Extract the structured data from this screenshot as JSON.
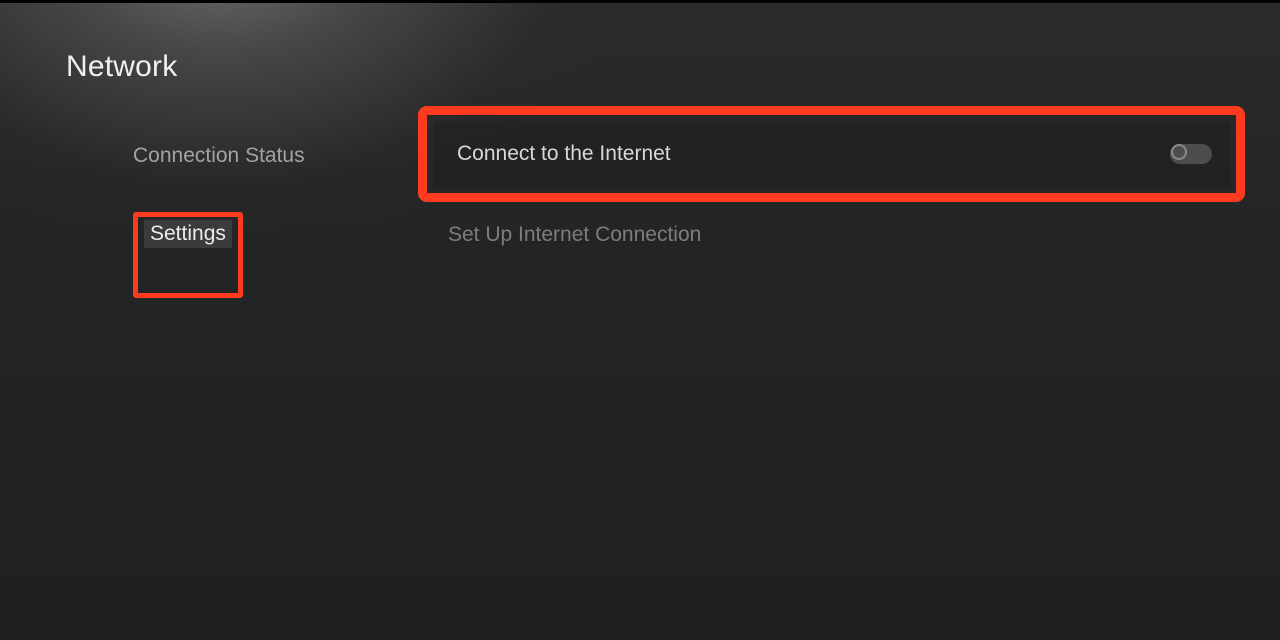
{
  "header": {
    "title": "Network"
  },
  "sidebar": {
    "items": [
      {
        "label": "Connection Status",
        "active": false
      },
      {
        "label": "Settings",
        "active": true
      }
    ]
  },
  "main": {
    "rows": [
      {
        "label": "Connect to the Internet",
        "toggle_state": "off"
      },
      {
        "label": "Set Up Internet Connection"
      }
    ]
  },
  "colors": {
    "highlight": "#ff3b1f"
  }
}
